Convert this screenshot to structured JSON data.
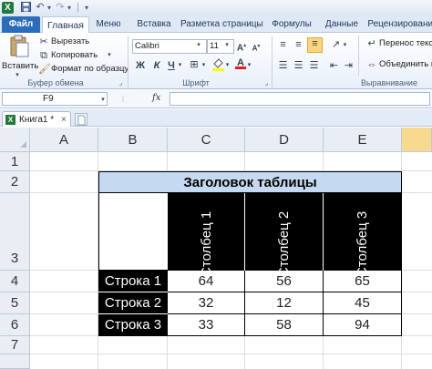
{
  "qat": {
    "app_icon": "excel-logo-icon",
    "letter": "X"
  },
  "tabs": [
    "Файл",
    "Главная",
    "Меню",
    "Вставка",
    "Разметка страницы",
    "Формулы",
    "Данные",
    "Рецензирование"
  ],
  "ribbon": {
    "clipboard": {
      "paste": "Вставить",
      "cut": "Вырезать",
      "copy": "Копировать",
      "format_painter": "Формат по образцу",
      "group": "Буфер обмена"
    },
    "font": {
      "name": "Calibri",
      "size": "11",
      "bold": "Ж",
      "italic": "К",
      "underline": "Ч",
      "group": "Шрифт"
    },
    "alignment": {
      "wrap": "Перенос текста",
      "merge": "Объединить и",
      "group": "Выравнивание"
    }
  },
  "formula_bar": {
    "name_box": "F9",
    "fx": "fx",
    "value": ""
  },
  "workbook_tab": {
    "label": "Книга1 *"
  },
  "sheet": {
    "columns": [
      "A",
      "B",
      "C",
      "D",
      "E"
    ],
    "rows": [
      "1",
      "2",
      "3",
      "4",
      "5",
      "6",
      "7"
    ],
    "title": "Заголовок таблицы",
    "col_headers": [
      "Столбец 1",
      "Столбец 2",
      "Столбец 3"
    ],
    "row_labels": [
      "Строка 1",
      "Строка 2",
      "Строка 3"
    ],
    "values": [
      [
        "64",
        "56",
        "65"
      ],
      [
        "32",
        "12",
        "45"
      ],
      [
        "33",
        "58",
        "94"
      ]
    ]
  },
  "colors": {
    "title_fill": "#c5d9f1",
    "dark_fill": "#000000",
    "selected_header": "#f9d98e",
    "file_tab": "#2a6db8"
  }
}
